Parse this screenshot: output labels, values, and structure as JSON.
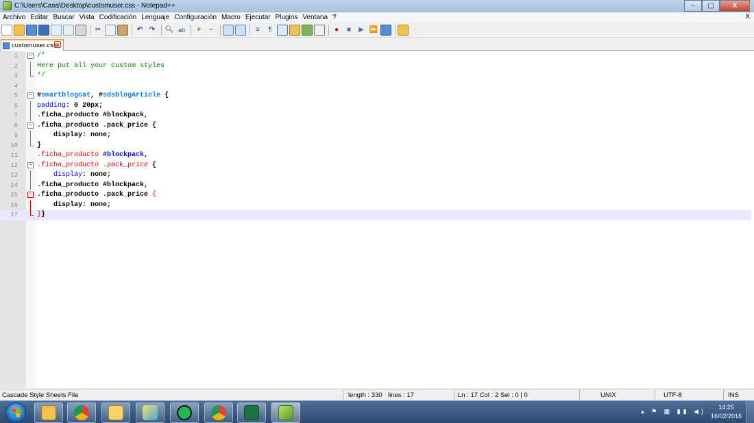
{
  "window": {
    "title": "C:\\Users\\Casa\\Desktop\\customuser.css - Notepad++",
    "minimize": "–",
    "maximize": "▢",
    "close": "X"
  },
  "menu": {
    "items": [
      "Archivo",
      "Editar",
      "Buscar",
      "Vista",
      "Codificación",
      "Lenguaje",
      "Configuración",
      "Macro",
      "Ejecutar",
      "Plugins",
      "Ventana",
      "?"
    ],
    "close_doc": "X"
  },
  "toolbar": {
    "icons": [
      "new-file",
      "open-file",
      "save",
      "save-all",
      "close",
      "close-all",
      "print",
      "cut",
      "copy",
      "paste",
      "undo",
      "redo",
      "find",
      "replace",
      "zoom-in",
      "zoom-out",
      "sync-v",
      "sync-h",
      "word-wrap",
      "show-all",
      "indent-guide",
      "document-map",
      "function-list",
      "folder-workspace",
      "record-macro",
      "stop-record",
      "play-macro",
      "run-macro-multiple",
      "save-macro",
      "spell-check"
    ]
  },
  "tab": {
    "label": "customuser.css",
    "close": "✕"
  },
  "editor": {
    "lines": [
      {
        "n": "1",
        "parts": [
          {
            "t": "/*",
            "c": "c-comment"
          }
        ]
      },
      {
        "n": "2",
        "parts": [
          {
            "t": "Here put all your custom styles",
            "c": "c-comment"
          }
        ]
      },
      {
        "n": "3",
        "parts": [
          {
            "t": "*/",
            "c": "c-comment"
          }
        ]
      },
      {
        "n": "4",
        "parts": []
      },
      {
        "n": "5",
        "parts": [
          {
            "t": "#",
            "c": "c-default"
          },
          {
            "t": "smartblogcat",
            "c": "c-idsel"
          },
          {
            "t": ", #",
            "c": "c-default"
          },
          {
            "t": "sdsblogArticle",
            "c": "c-idsel"
          },
          {
            "t": " {",
            "c": "c-default"
          }
        ]
      },
      {
        "n": "6",
        "parts": [
          {
            "t": "padding",
            "c": "c-prop"
          },
          {
            "t": ": 0 20px;",
            "c": "c-default"
          }
        ]
      },
      {
        "n": "7",
        "parts": [
          {
            "t": ".ficha_producto #blockpack,",
            "c": "c-default"
          }
        ]
      },
      {
        "n": "8",
        "parts": [
          {
            "t": ".ficha_producto .pack_price {",
            "c": "c-default"
          }
        ]
      },
      {
        "n": "9",
        "parts": [
          {
            "t": "    display: none;",
            "c": "c-default"
          }
        ]
      },
      {
        "n": "10",
        "parts": [
          {
            "t": "}",
            "c": "c-default"
          }
        ]
      },
      {
        "n": "11",
        "parts": [
          {
            "t": ".ficha_producto ",
            "c": "c-redsel"
          },
          {
            "t": "#blockpack",
            "c": "c-blue"
          },
          {
            "t": ",",
            "c": "c-default"
          }
        ]
      },
      {
        "n": "12",
        "parts": [
          {
            "t": ".ficha_producto .pack_price",
            "c": "c-redsel"
          },
          {
            "t": " {",
            "c": "c-default"
          }
        ]
      },
      {
        "n": "13",
        "parts": [
          {
            "t": "    ",
            "c": "c-default"
          },
          {
            "t": "display",
            "c": "c-prop"
          },
          {
            "t": ": none;",
            "c": "c-default"
          }
        ]
      },
      {
        "n": "14",
        "parts": [
          {
            "t": ".ficha_producto #blockpack,",
            "c": "c-default"
          }
        ]
      },
      {
        "n": "15",
        "parts": [
          {
            "t": ".ficha_producto .pack_price ",
            "c": "c-default"
          },
          {
            "t": "{",
            "c": "c-red"
          }
        ]
      },
      {
        "n": "16",
        "parts": [
          {
            "t": "    display: none;",
            "c": "c-default"
          }
        ]
      },
      {
        "n": "17",
        "parts": [
          {
            "t": "}",
            "c": "c-red"
          },
          {
            "t": "}",
            "c": "c-default"
          }
        ]
      }
    ],
    "current_line": "17"
  },
  "status": {
    "file_type": "Cascade Style Sheets File",
    "length": "length : 330",
    "lines": "lines : 17",
    "position": "Ln : 17    Col : 2    Sel : 0 | 0",
    "eol": "UNIX",
    "encoding": "UTF-8",
    "mode": "INS"
  },
  "taskbar": {
    "apps": [
      "explorer",
      "chrome",
      "outlook",
      "pen-tool",
      "spotify",
      "chrome-2",
      "excel",
      "notepad-plus-plus"
    ],
    "clock_time": "14:25",
    "clock_date": "16/02/2016",
    "tray": "▴  ⚑  ▦  ▮▮  ◀)"
  },
  "colors": {
    "comment": "#008000",
    "id_selector": "#0080ff",
    "property": "#0000ff",
    "brace_highlight": "#ff0000",
    "current_line": "#e8e8ff"
  }
}
